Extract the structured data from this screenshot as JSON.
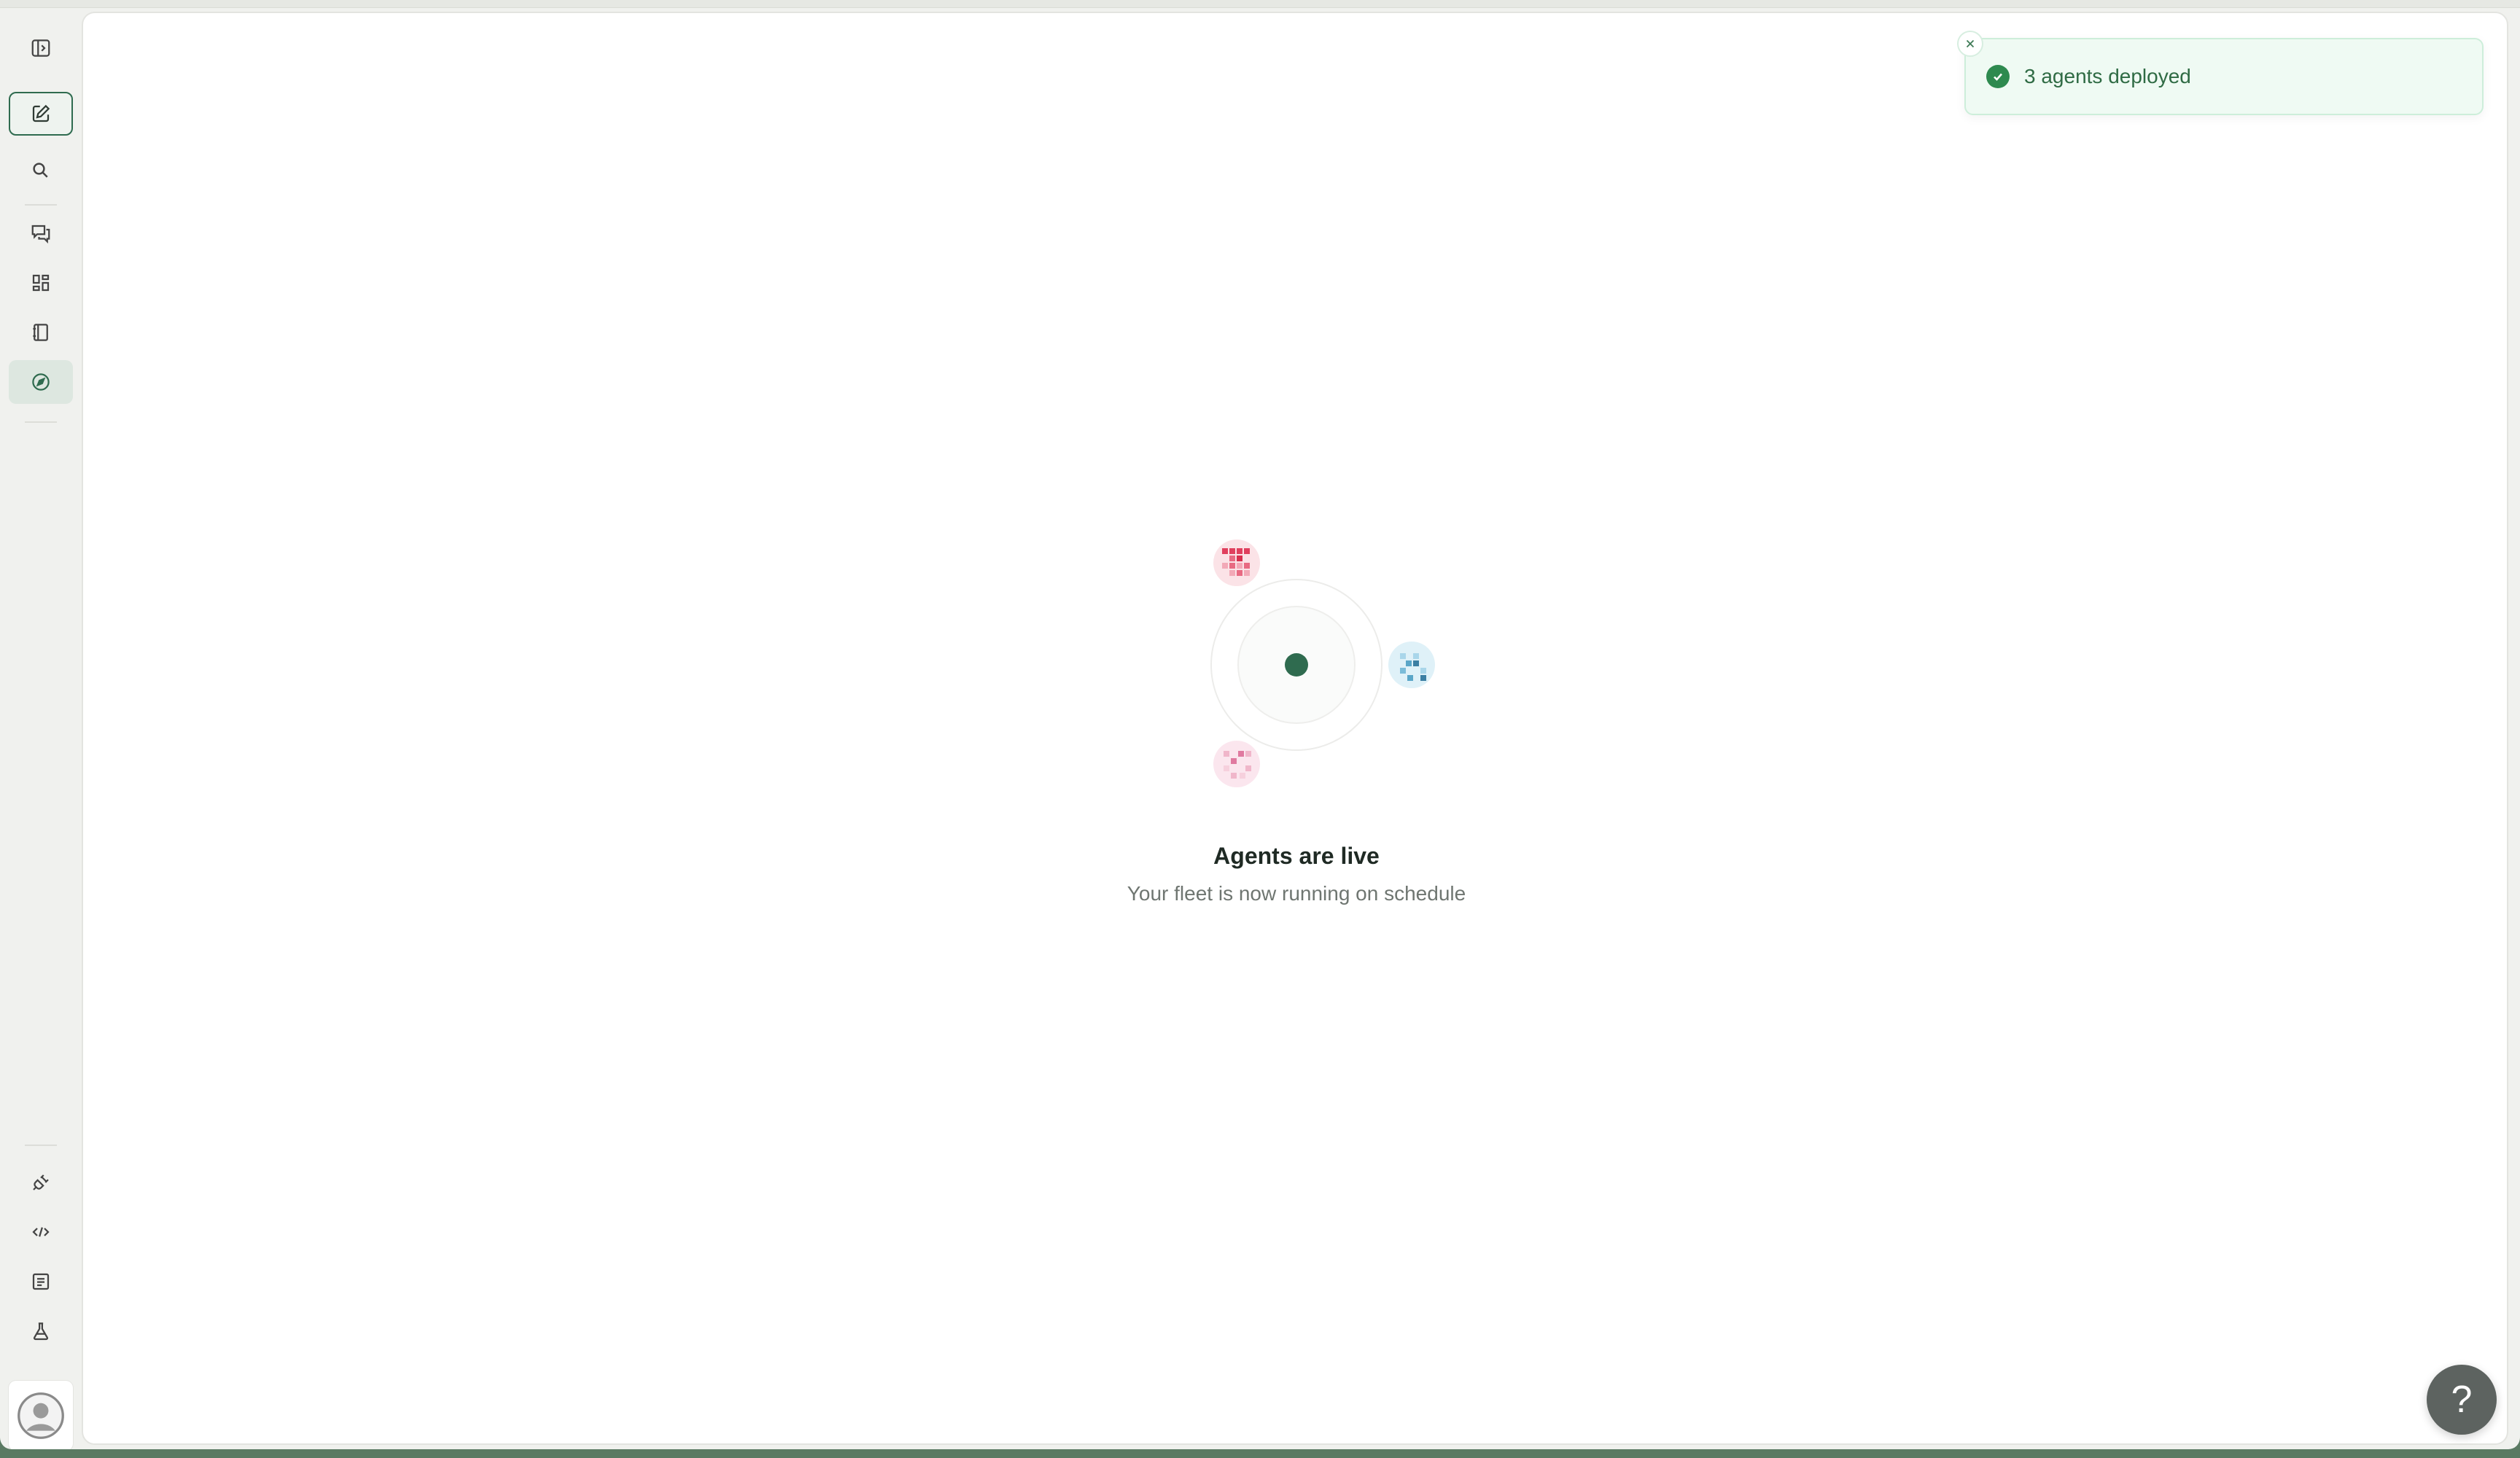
{
  "toast": {
    "message": "3 agents deployed",
    "status_color": "#2e8a4f"
  },
  "status": {
    "title": "Agents are live",
    "subtitle": "Your fleet is now running on schedule"
  },
  "help": {
    "label": "?"
  },
  "sidebar": {
    "items": [
      {
        "name": "toggle-sidebar",
        "icon": "sidebar-panel-icon"
      },
      {
        "name": "new-chat",
        "icon": "compose-icon",
        "state": "outlined"
      },
      {
        "name": "search",
        "icon": "search-icon"
      },
      {
        "name": "conversations",
        "icon": "chat-bubbles-icon"
      },
      {
        "name": "dashboard",
        "icon": "grid-icon"
      },
      {
        "name": "notebook",
        "icon": "notebook-icon"
      },
      {
        "name": "explore",
        "icon": "compass-icon",
        "state": "active"
      },
      {
        "name": "integrations",
        "icon": "plug-icon"
      },
      {
        "name": "developer",
        "icon": "code-icon"
      },
      {
        "name": "logs",
        "icon": "document-icon"
      },
      {
        "name": "labs",
        "icon": "flask-icon"
      },
      {
        "name": "profile",
        "icon": "avatar-icon"
      }
    ]
  },
  "colors": {
    "accent": "#2f6b4f",
    "active_bg": "#dde7e0",
    "agent_red": "#e0405e",
    "agent_blue": "#5aa6c8",
    "agent_pink": "#e07aa0"
  }
}
